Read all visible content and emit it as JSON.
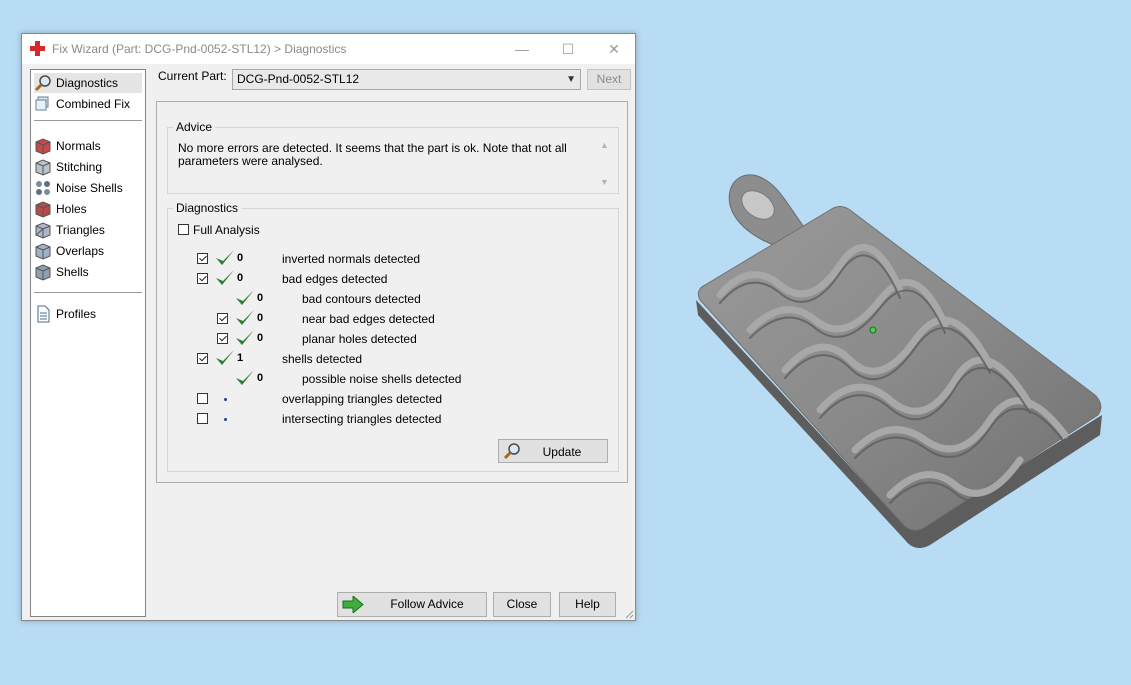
{
  "window": {
    "title": "Fix Wizard (Part: DCG-Pnd-0052-STL12) > Diagnostics",
    "controls": {
      "minimize": "—",
      "maximize": "☐",
      "close": "✕"
    }
  },
  "sidebar": {
    "items": [
      {
        "label": "Diagnostics",
        "icon": "magnifier-icon",
        "selected": true
      },
      {
        "label": "Combined Fix",
        "icon": "cube-stack-icon"
      },
      {
        "label": "Normals",
        "icon": "normals-cube-icon"
      },
      {
        "label": "Stitching",
        "icon": "stitching-cube-icon"
      },
      {
        "label": "Noise Shells",
        "icon": "noise-shells-icon"
      },
      {
        "label": "Holes",
        "icon": "holes-cube-icon"
      },
      {
        "label": "Triangles",
        "icon": "triangles-cube-icon"
      },
      {
        "label": "Overlaps",
        "icon": "overlaps-cube-icon"
      },
      {
        "label": "Shells",
        "icon": "shells-cube-icon"
      },
      {
        "label": "Profiles",
        "icon": "document-icon"
      }
    ]
  },
  "current_part": {
    "label": "Current Part:",
    "value": "DCG-Pnd-0052-STL12",
    "next_label": "Next"
  },
  "advice": {
    "title": "Advice",
    "text": "No more errors are detected. It seems that the part is ok. Note that not all parameters were analysed."
  },
  "diagnostics": {
    "title": "Diagnostics",
    "full_analysis_label": "Full Analysis",
    "full_analysis_checked": false,
    "rows": [
      {
        "checkbox": true,
        "checked": true,
        "status": "ok",
        "count": "0",
        "label": "inverted normals detected"
      },
      {
        "checkbox": true,
        "checked": true,
        "status": "ok",
        "count": "0",
        "label": "bad edges detected"
      },
      {
        "checkbox": false,
        "status": "ok",
        "count": "0",
        "label": "bad contours detected"
      },
      {
        "checkbox": true,
        "checked": true,
        "status": "ok",
        "count": "0",
        "label": "near bad edges detected"
      },
      {
        "checkbox": true,
        "checked": true,
        "status": "ok",
        "count": "0",
        "label": "planar holes detected"
      },
      {
        "checkbox": true,
        "checked": true,
        "status": "ok",
        "count": "1",
        "label": "shells detected"
      },
      {
        "checkbox": false,
        "status": "ok",
        "count": "0",
        "label": "possible noise shells detected"
      },
      {
        "checkbox": true,
        "checked": false,
        "status": "not-analysed",
        "count": "",
        "label": "overlapping triangles detected"
      },
      {
        "checkbox": true,
        "checked": false,
        "status": "not-analysed",
        "count": "",
        "label": "intersecting triangles detected"
      }
    ],
    "update_label": "Update"
  },
  "buttons": {
    "follow_advice": "Follow Advice",
    "close": "Close",
    "help": "Help"
  },
  "colors": {
    "viewport_background": "#b9dcf5",
    "check_green": "#2e7d32",
    "model_gray": "#8c8c8c",
    "title_gray": "#8a8a8a"
  }
}
